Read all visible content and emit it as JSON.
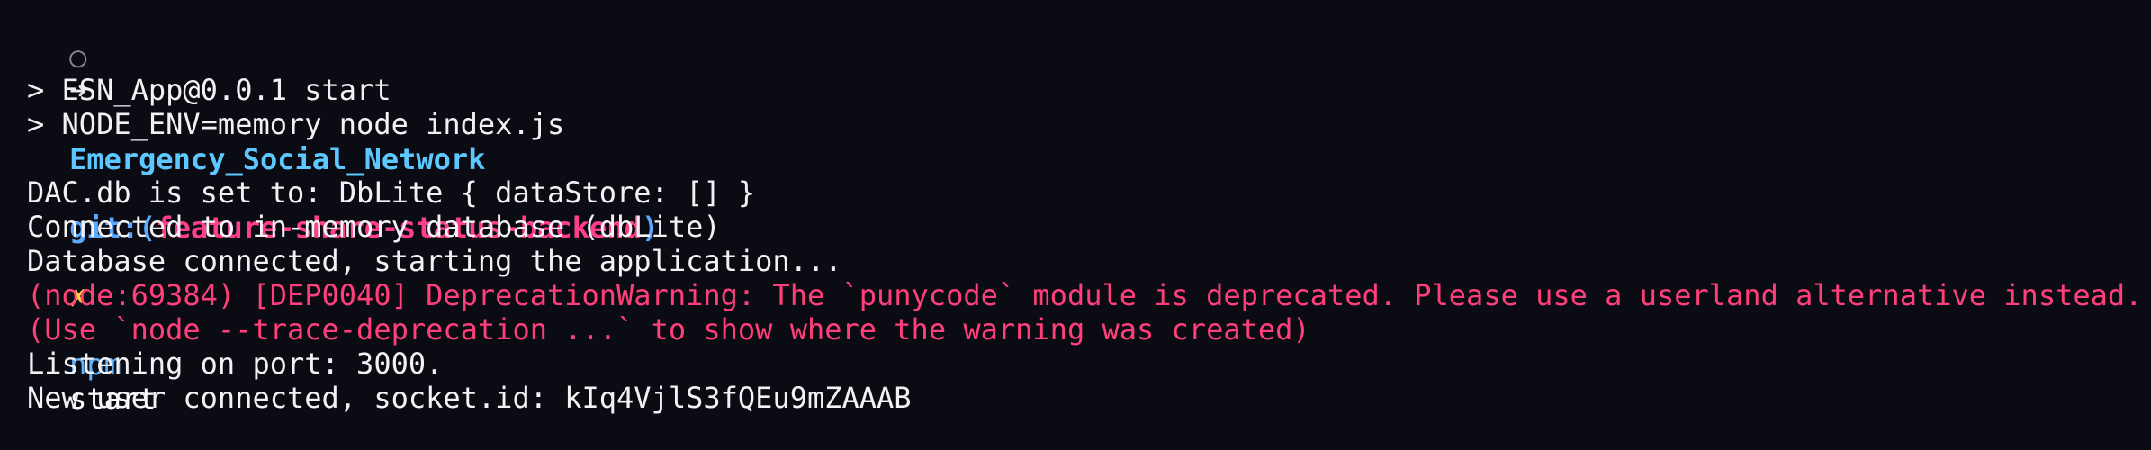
{
  "top_cut_text": "⠀⠀⠀⠀⠀⠀⠀⠀⠀⠀⠀⠀⠀⠀⠀⠀⠀⠀⠀⠀⠀⠀⠀⠀⠀⠀⠀⠀⠀⠀⠀⠀⠀⠀⠀⠀⠀⠀⠀⠀⠀⠀⠀⠀⠀⠀⠀⠀⠀⠀⠀⠀⠀⠀⠀⠀⠀⠀⠀⠀",
  "prompt": {
    "circle": "○",
    "arrow": "➜",
    "directory": "Emergency_Social_Network",
    "git_prefix": "git:(",
    "branch": "feature-share-status-backend",
    "git_suffix": ")",
    "dirty_marker": "✗",
    "command": "npm",
    "args": "start"
  },
  "output_lines": [
    {
      "text": "> ESN_App@0.0.1 start",
      "kind": "normal"
    },
    {
      "text": "> NODE_ENV=memory node index.js",
      "kind": "normal"
    },
    {
      "text": "DAC.db is set to: DbLite { dataStore: [] }",
      "kind": "normal"
    },
    {
      "text": "Connected to in-memory database (dbLite)",
      "kind": "normal"
    },
    {
      "text": "Database connected, starting the application...",
      "kind": "normal"
    },
    {
      "text": "(node:69384) [DEP0040] DeprecationWarning: The `punycode` module is deprecated. Please use a userland alternative instead.",
      "kind": "warning"
    },
    {
      "text": "(Use `node --trace-deprecation ...` to show where the warning was created)",
      "kind": "warning"
    },
    {
      "text": "Listening on port: 3000.",
      "kind": "normal"
    },
    {
      "text": "New user connected, socket.id: kIq4VjlS3fQEu9mZAAAB",
      "kind": "normal"
    }
  ],
  "colors": {
    "background": "#0b0b14",
    "text": "#f2f2f2",
    "directory": "#5cc8ff",
    "branch": "#ff3f8a",
    "dirty": "#ffd23f",
    "warning": "#ff3f7a"
  }
}
